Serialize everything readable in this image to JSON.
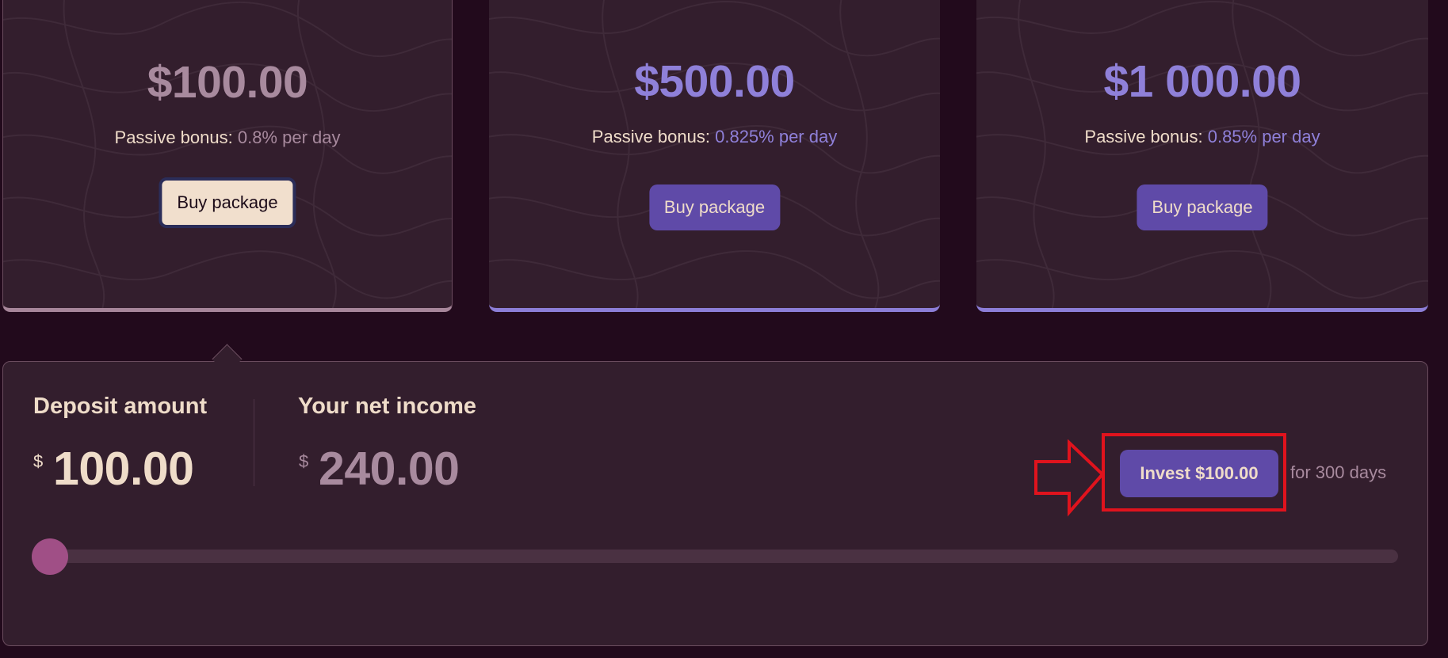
{
  "packages": [
    {
      "price": "$100.00",
      "bonus_label": "Passive bonus:",
      "bonus_value": "0.8% per day",
      "button": "Buy package",
      "state": "selected"
    },
    {
      "price": "$500.00",
      "bonus_label": "Passive bonus:",
      "bonus_value": "0.825% per day",
      "button": "Buy package",
      "state": "default"
    },
    {
      "price": "$1 000.00",
      "bonus_label": "Passive bonus:",
      "bonus_value": "0.85% per day",
      "button": "Buy package",
      "state": "default"
    }
  ],
  "calculator": {
    "deposit_label": "Deposit amount",
    "deposit_currency": "$",
    "deposit_value": "100.00",
    "income_label": "Your net income",
    "income_currency": "$",
    "income_value": "240.00",
    "invest_button": "Invest $100.00",
    "duration": "for 300 days",
    "slider_fraction": 0
  },
  "colors": {
    "background": "#220a1c",
    "card": "#331e2d",
    "accent": "#5f4aa8",
    "accent_text": "#8f80d9",
    "muted": "#a88a9e",
    "cream": "#efdcc9",
    "annotation": "#e0131d",
    "slider_thumb": "#a04f86"
  },
  "icons": [
    "topographic-pattern-icon",
    "right-arrow-annotation-icon"
  ]
}
